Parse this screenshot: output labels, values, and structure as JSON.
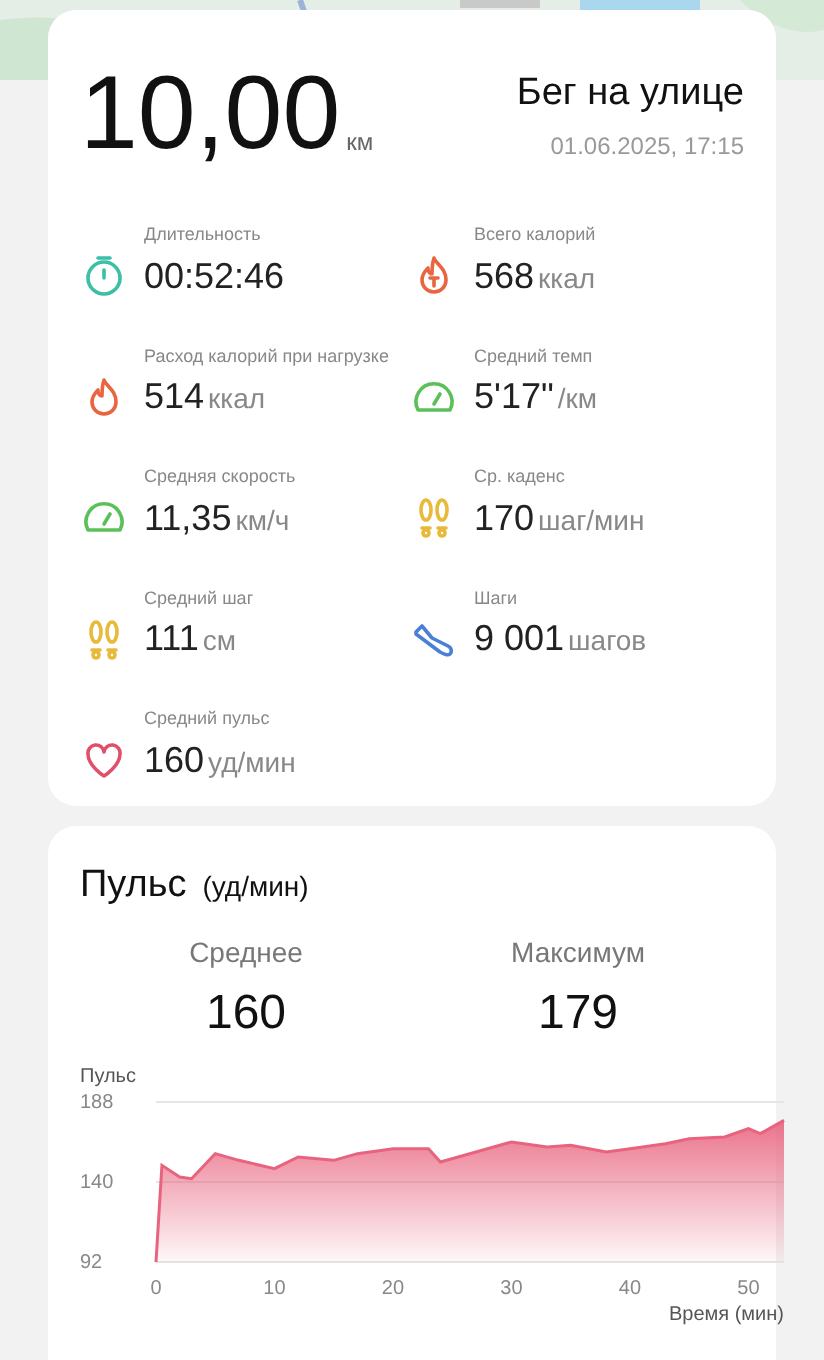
{
  "summary": {
    "distance": "10,00",
    "distance_unit": "км",
    "activity": "Бег на улице",
    "datetime": "01.06.2025, 17:15"
  },
  "stats": [
    {
      "kind": "stopwatch",
      "label": "Длительность",
      "value": "00:52:46"
    },
    {
      "kind": "calorie",
      "label": "Всего калорий",
      "value": "568",
      "unit": "ккал"
    },
    {
      "kind": "flame",
      "label": "Расход калорий при нагрузке",
      "value": "514",
      "unit": "ккал"
    },
    {
      "kind": "gauge",
      "label": "Средний темп",
      "value": "5'17\"",
      "unit": "/км"
    },
    {
      "kind": "gauge",
      "label": "Средняя скорость",
      "value": "11,35",
      "unit": "км/ч"
    },
    {
      "kind": "footprints",
      "label": "Ср. каденс",
      "value": "170",
      "unit": "шаг/мин"
    },
    {
      "kind": "footprints",
      "label": "Средний шаг",
      "value": "111",
      "unit": "см"
    },
    {
      "kind": "shoe",
      "label": "Шаги",
      "value": "9 001",
      "unit": "шагов"
    },
    {
      "kind": "heart",
      "label": "Средний пульс",
      "value": "160",
      "unit": "уд/мин"
    }
  ],
  "heart_rate": {
    "title": "Пульс",
    "unit": "(уд/мин)",
    "average_label": "Среднее",
    "average": "160",
    "max_label": "Максимум",
    "max": "179",
    "chart_data": {
      "type": "area",
      "ylabel": "Пульс",
      "xlabel": "Время (мин)",
      "ylim": [
        92,
        188
      ],
      "yticks": [
        92,
        140,
        188
      ],
      "xticks": [
        0,
        10,
        20,
        30,
        40,
        50
      ],
      "xlim": [
        0,
        53
      ],
      "x": [
        0,
        0.5,
        2,
        3,
        5,
        7,
        10,
        12,
        15,
        17,
        20,
        23,
        24,
        27,
        30,
        33,
        35,
        38,
        40,
        43,
        45,
        48,
        50,
        51,
        53
      ],
      "series": [
        {
          "color": "#e8637e",
          "values": [
            92,
            150,
            143,
            142,
            157,
            153,
            148,
            155,
            153,
            157,
            160,
            160,
            152,
            158,
            164,
            161,
            162,
            158,
            160,
            163,
            166,
            167,
            172,
            169,
            177
          ]
        }
      ]
    }
  }
}
